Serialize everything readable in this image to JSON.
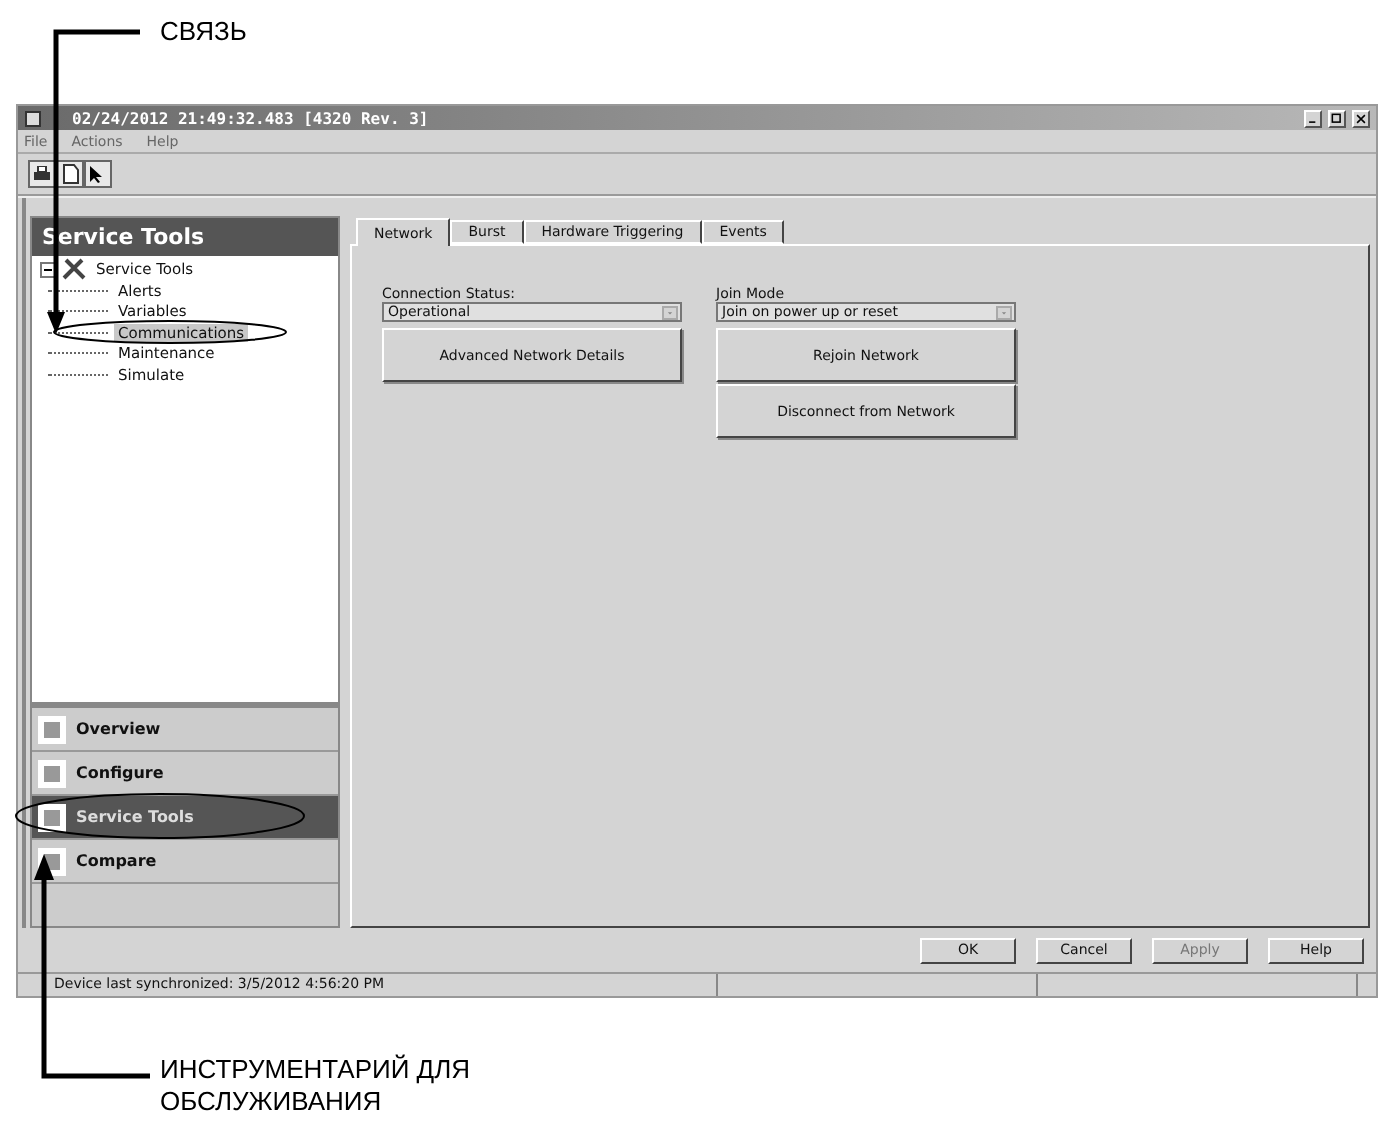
{
  "annotations": [
    {
      "kind": "top",
      "text": "СВЯЗЬ"
    },
    {
      "kind": "bottom",
      "text": "ИНСТРУМЕНТАРИЙ ДЛЯ ОБСЛУЖИВАНИЯ"
    }
  ],
  "window": {
    "title": "02/24/2012 21:49:32.483 [4320 Rev. 3]"
  },
  "menu": [
    "File",
    "Actions",
    "Help"
  ],
  "sidebar": {
    "title": "Service Tools",
    "tree": {
      "label": "Service Tools",
      "expanded": true,
      "children": [
        {
          "label": "Alerts",
          "selected": false
        },
        {
          "label": "Variables",
          "selected": false
        },
        {
          "label": "Communications",
          "selected": true
        },
        {
          "label": "Maintenance",
          "selected": false
        },
        {
          "label": "Simulate",
          "selected": false
        }
      ]
    },
    "nav": [
      {
        "label": "Overview",
        "selected": false
      },
      {
        "label": "Configure",
        "selected": false
      },
      {
        "label": "Service Tools",
        "selected": true
      },
      {
        "label": "Compare",
        "selected": false
      }
    ]
  },
  "tabs": [
    {
      "label": "Network",
      "selected": true
    },
    {
      "label": "Burst",
      "selected": false
    },
    {
      "label": "Hardware Triggering",
      "selected": false
    },
    {
      "label": "Events",
      "selected": false
    }
  ],
  "fields": [
    {
      "label": "Connection Status:",
      "value": "Operational",
      "buttons": [
        "Advanced Network Details"
      ]
    },
    {
      "label": "Join Mode",
      "value": "Join on power up or reset",
      "buttons": [
        "Rejoin Network",
        "Disconnect from Network"
      ]
    }
  ],
  "dialog_buttons": [
    {
      "label": "OK",
      "disabled": false
    },
    {
      "label": "Cancel",
      "disabled": false
    },
    {
      "label": "Apply",
      "disabled": true
    },
    {
      "label": "Help",
      "disabled": false
    }
  ],
  "status_bar": "Device last synchronized: 3/5/2012 4:56:20 PM"
}
